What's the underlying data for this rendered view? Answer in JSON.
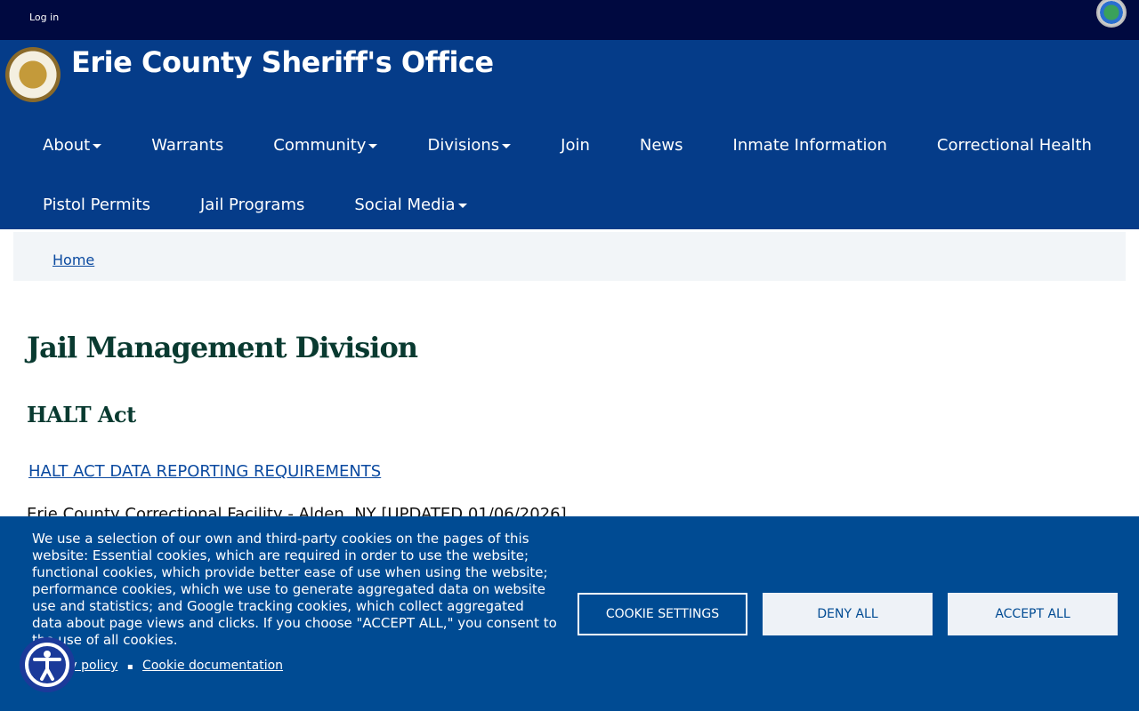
{
  "topbar": {
    "login": "Log in"
  },
  "header": {
    "title": "Erie County Sheriff's Office"
  },
  "nav": {
    "row1": [
      {
        "label": "About",
        "dropdown": true
      },
      {
        "label": "Warrants",
        "dropdown": false
      },
      {
        "label": "Community",
        "dropdown": true
      },
      {
        "label": "Divisions",
        "dropdown": true
      },
      {
        "label": "Join",
        "dropdown": false
      },
      {
        "label": "News",
        "dropdown": false
      },
      {
        "label": "Inmate Information",
        "dropdown": false
      },
      {
        "label": "Correctional Health",
        "dropdown": false
      }
    ],
    "row2": [
      {
        "label": "Pistol Permits",
        "dropdown": false
      },
      {
        "label": "Jail Programs",
        "dropdown": false
      },
      {
        "label": "Social Media",
        "dropdown": true
      }
    ]
  },
  "breadcrumb": {
    "home": "Home"
  },
  "main": {
    "title": "Jail Management Division",
    "subtitle": "HALT Act",
    "link": "HALT ACT DATA REPORTING REQUIREMENTS",
    "facility": "Erie County Correctional Facility - Alden, NY [UPDATED 01/06/2026]"
  },
  "cookie": {
    "text": "We use a selection of our own and third-party cookies on the pages of this website: Essential cookies, which are required in order to use the website; functional cookies, which provide better ease of use when using the website; performance cookies, which we use to generate aggregated data on website use and statistics; and Google tracking cookies, which collect aggregated data about page views and clicks. If you choose \"ACCEPT ALL,\" you consent to the use of all cookies.",
    "privacy": "Privacy policy",
    "separator": "▪",
    "documentation": "Cookie documentation",
    "settings": "COOKIE SETTINGS",
    "deny": "DENY ALL",
    "accept": "ACCEPT ALL"
  },
  "colors": {
    "topbar": "#000940",
    "header": "#053c89",
    "banner": "#004b93",
    "heading": "#093a30"
  }
}
